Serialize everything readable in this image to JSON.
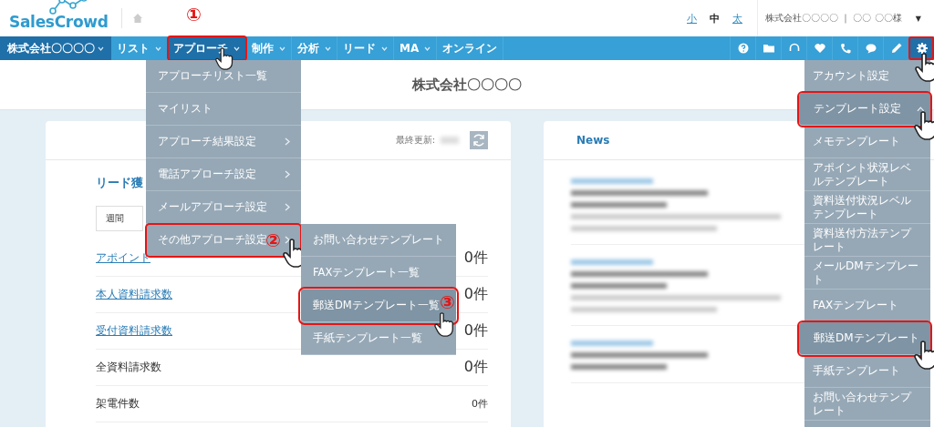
{
  "header": {
    "logo": "SalesCrowd",
    "font_sizes": [
      {
        "label": "小",
        "selected": false
      },
      {
        "label": "中",
        "selected": true
      },
      {
        "label": "太",
        "selected": false
      }
    ],
    "account": "株式会社〇〇〇〇 ｜ 〇〇 〇〇様",
    "account_caret": "▼"
  },
  "nav": {
    "company": "株式会社〇〇〇〇",
    "items": [
      {
        "label": "リスト",
        "dropdown": true,
        "selected": false,
        "highlighted": false,
        "pointer": false
      },
      {
        "label": "アプローチ",
        "dropdown": true,
        "selected": true,
        "highlighted": true,
        "pointer": true,
        "step": "①"
      },
      {
        "label": "制作",
        "dropdown": true,
        "selected": false,
        "highlighted": false,
        "pointer": false
      },
      {
        "label": "分析",
        "dropdown": true,
        "selected": false,
        "highlighted": false,
        "pointer": false
      },
      {
        "label": "リード",
        "dropdown": true,
        "selected": false,
        "highlighted": false,
        "pointer": false
      },
      {
        "label": "MA",
        "dropdown": true,
        "selected": false,
        "highlighted": false,
        "pointer": false
      },
      {
        "label": "オンライン",
        "dropdown": false,
        "selected": false,
        "highlighted": false,
        "pointer": false
      }
    ],
    "tools": [
      {
        "selected": false
      },
      {
        "selected": false
      },
      {
        "selected": false
      },
      {
        "selected": false
      },
      {
        "selected": false
      },
      {
        "selected": false
      },
      {
        "selected": false
      },
      {
        "selected": true,
        "highlighted": true,
        "pointer": true
      }
    ]
  },
  "page_title": "株式会社〇〇〇〇",
  "summary": {
    "last_updated_label": "最終更新:",
    "heading": "リード獲",
    "period": "週間",
    "rows": [
      {
        "label": "アポイント",
        "link": true,
        "value": "0件"
      },
      {
        "label": "本人資料請求数",
        "link": true,
        "value": "0件"
      },
      {
        "label": "受付資料請求数",
        "link": true,
        "value": "0件"
      },
      {
        "label": "全資料請求数",
        "link": false,
        "value": "0件"
      },
      {
        "label": "架電件数",
        "link": false,
        "value": "0件"
      }
    ]
  },
  "news": {
    "title": "News"
  },
  "approach_menu": [
    {
      "label": "アプローチリスト一覧",
      "submenu": false,
      "selected": false,
      "highlighted": false,
      "pointer": false
    },
    {
      "label": "マイリスト",
      "submenu": false,
      "selected": false,
      "highlighted": false,
      "pointer": false
    },
    {
      "label": "アプローチ結果設定",
      "submenu": true,
      "selected": false,
      "highlighted": false,
      "pointer": false
    },
    {
      "label": "電話アプローチ設定",
      "submenu": true,
      "selected": false,
      "highlighted": false,
      "pointer": false
    },
    {
      "label": "メールアプローチ設定",
      "submenu": true,
      "selected": false,
      "highlighted": false,
      "pointer": false
    },
    {
      "label": "その他アプローチ設定",
      "submenu": true,
      "selected": false,
      "highlighted": true,
      "pointer": true,
      "step": "②"
    }
  ],
  "other_submenu": [
    {
      "label": "お問い合わせテンプレート",
      "selected": false,
      "highlighted": false,
      "pointer": false
    },
    {
      "label": "FAXテンプレート一覧",
      "selected": false,
      "highlighted": false,
      "pointer": false
    },
    {
      "label": "郵送DMテンプレート一覧",
      "selected": true,
      "highlighted": true,
      "pointer": true,
      "step": "③"
    },
    {
      "label": "手紙テンプレート一覧",
      "selected": false,
      "highlighted": false,
      "pointer": false
    }
  ],
  "settings_menu": [
    {
      "label": "アカウント設定",
      "selected": false,
      "highlighted": false,
      "pointer": false
    },
    {
      "label": "テンプレート設定",
      "selected": true,
      "highlighted": true,
      "pointer": true,
      "expanded": true
    },
    {
      "label": "メモテンプレート",
      "selected": false,
      "highlighted": false,
      "pointer": false
    },
    {
      "label": "アポイント状況レベルテンプレート",
      "selected": false,
      "highlighted": false,
      "pointer": false
    },
    {
      "label": "資料送付状況レベルテンプレート",
      "selected": false,
      "highlighted": false,
      "pointer": false
    },
    {
      "label": "資料送付方法テンプレート",
      "selected": false,
      "highlighted": false,
      "pointer": false
    },
    {
      "label": "メールDMテンプレート",
      "selected": false,
      "highlighted": false,
      "pointer": false
    },
    {
      "label": "FAXテンプレート",
      "selected": false,
      "highlighted": false,
      "pointer": false
    },
    {
      "label": "郵送DMテンプレート",
      "selected": true,
      "highlighted": true,
      "pointer": true
    },
    {
      "label": "手紙テンプレート",
      "selected": false,
      "highlighted": false,
      "pointer": false
    },
    {
      "label": "お問い合わせテンプレート",
      "selected": false,
      "highlighted": false,
      "pointer": false
    }
  ]
}
